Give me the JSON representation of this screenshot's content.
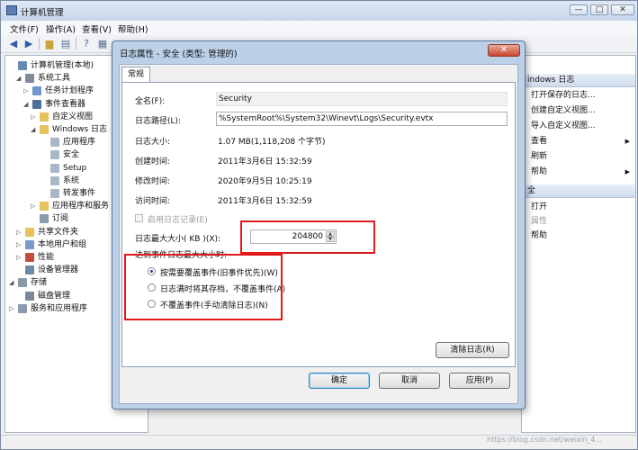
{
  "window": {
    "title": "计算机管理",
    "min": "—",
    "max": "□",
    "close": "✕"
  },
  "menu": [
    "文件(F)",
    "操作(A)",
    "查看(V)",
    "帮助(H)"
  ],
  "toolbar_icons": [
    "back-arrow",
    "forward-arrow",
    "up-folder",
    "show-hide-tree",
    "properties",
    "help",
    "show-action-pane"
  ],
  "tree": [
    {
      "label": "计算机管理(本地)",
      "icon": "computer",
      "exp": "",
      "color": "#6a88b6"
    },
    {
      "label": "系统工具",
      "icon": "tools",
      "exp": "◢",
      "color": "#7c8a9a"
    },
    {
      "label": "任务计划程序",
      "icon": "clock",
      "exp": "▷",
      "color": "#6f96c9"
    },
    {
      "label": "事件查看器",
      "icon": "event-viewer",
      "exp": "◢",
      "color": "#4d6f9c"
    },
    {
      "label": "自定义视图",
      "icon": "folder",
      "exp": "▷",
      "color": "#e5c25c"
    },
    {
      "label": "Windows 日志",
      "icon": "folder",
      "exp": "◢",
      "color": "#e5c25c"
    },
    {
      "label": "应用程序",
      "icon": "log",
      "exp": "",
      "color": "#a9b7c8"
    },
    {
      "label": "安全",
      "icon": "log",
      "exp": "",
      "color": "#a9b7c8"
    },
    {
      "label": "Setup",
      "icon": "log",
      "exp": "",
      "color": "#a9b7c8"
    },
    {
      "label": "系统",
      "icon": "log",
      "exp": "",
      "color": "#a9b7c8"
    },
    {
      "label": "转发事件",
      "icon": "log",
      "exp": "",
      "color": "#a9b7c8"
    },
    {
      "label": "应用程序和服务",
      "icon": "folder",
      "exp": "▷",
      "color": "#e5c25c"
    },
    {
      "label": "订阅",
      "icon": "subscriptions",
      "exp": "",
      "color": "#8a9ab0"
    },
    {
      "label": "共享文件夹",
      "icon": "shared-folder",
      "exp": "▷",
      "color": "#e5c25c"
    },
    {
      "label": "本地用户和组",
      "icon": "users",
      "exp": "▷",
      "color": "#7b9acb"
    },
    {
      "label": "性能",
      "icon": "performance",
      "exp": "▷",
      "color": "#c24b3c"
    },
    {
      "label": "设备管理器",
      "icon": "device-manager",
      "exp": "",
      "color": "#6b8aa8"
    },
    {
      "label": "存储",
      "icon": "storage",
      "exp": "◢",
      "color": "#8c98a6"
    },
    {
      "label": "磁盘管理",
      "icon": "disk",
      "exp": "",
      "color": "#7a8896"
    },
    {
      "label": "服务和应用程序",
      "icon": "services",
      "exp": "▷",
      "color": "#8a9ab0"
    }
  ],
  "actions": {
    "section1": "indows 日志",
    "items1": [
      {
        "label": "打开保存的日志...",
        "arrow": ""
      },
      {
        "label": "创建自定义视图...",
        "arrow": ""
      },
      {
        "label": "导入自定义视图...",
        "arrow": ""
      },
      {
        "label": "查看",
        "arrow": "▶"
      },
      {
        "label": "刷新",
        "arrow": ""
      },
      {
        "label": "帮助",
        "arrow": "▶"
      }
    ],
    "section2": "全",
    "items2": [
      {
        "label": "打开",
        "arrow": ""
      },
      {
        "label": "属性",
        "arrow": ""
      },
      {
        "label": "帮助",
        "arrow": ""
      }
    ]
  },
  "dialog": {
    "title": "日志属性 - 安全 (类型: 管理的)",
    "close": "✕",
    "tab": "常规",
    "fullname_label": "全名(F):",
    "fullname": "Security",
    "path_label": "日志路径(L):",
    "path": "%SystemRoot%\\System32\\Winevt\\Logs\\Security.evtx",
    "size_label": "日志大小:",
    "size": "1.07 MB(1,118,208 个字节)",
    "created_label": "创建时间:",
    "created": "2011年3月6日 15:32:59",
    "modified_label": "修改时间:",
    "modified": "2020年9月5日 10:25:19",
    "accessed_label": "访问时间:",
    "accessed": "2011年3月6日 15:32:59",
    "enable_logging": "启用日志记录(E)",
    "maxsize_label": "日志最大大小( KB )(X):",
    "maxsize_value": "204800",
    "when_max_label": "达到事件日志最大大小时:",
    "options": [
      "按需要覆盖事件(旧事件优先)(W)",
      "日志满时将其存档，不覆盖事件(A)",
      "不覆盖事件(手动清除日志)(N)"
    ],
    "clear_log": "清除日志(R)",
    "ok": "确定",
    "cancel": "取消",
    "apply": "应用(P)"
  },
  "watermark": "https://blog.csdn.net/weixin_4..."
}
